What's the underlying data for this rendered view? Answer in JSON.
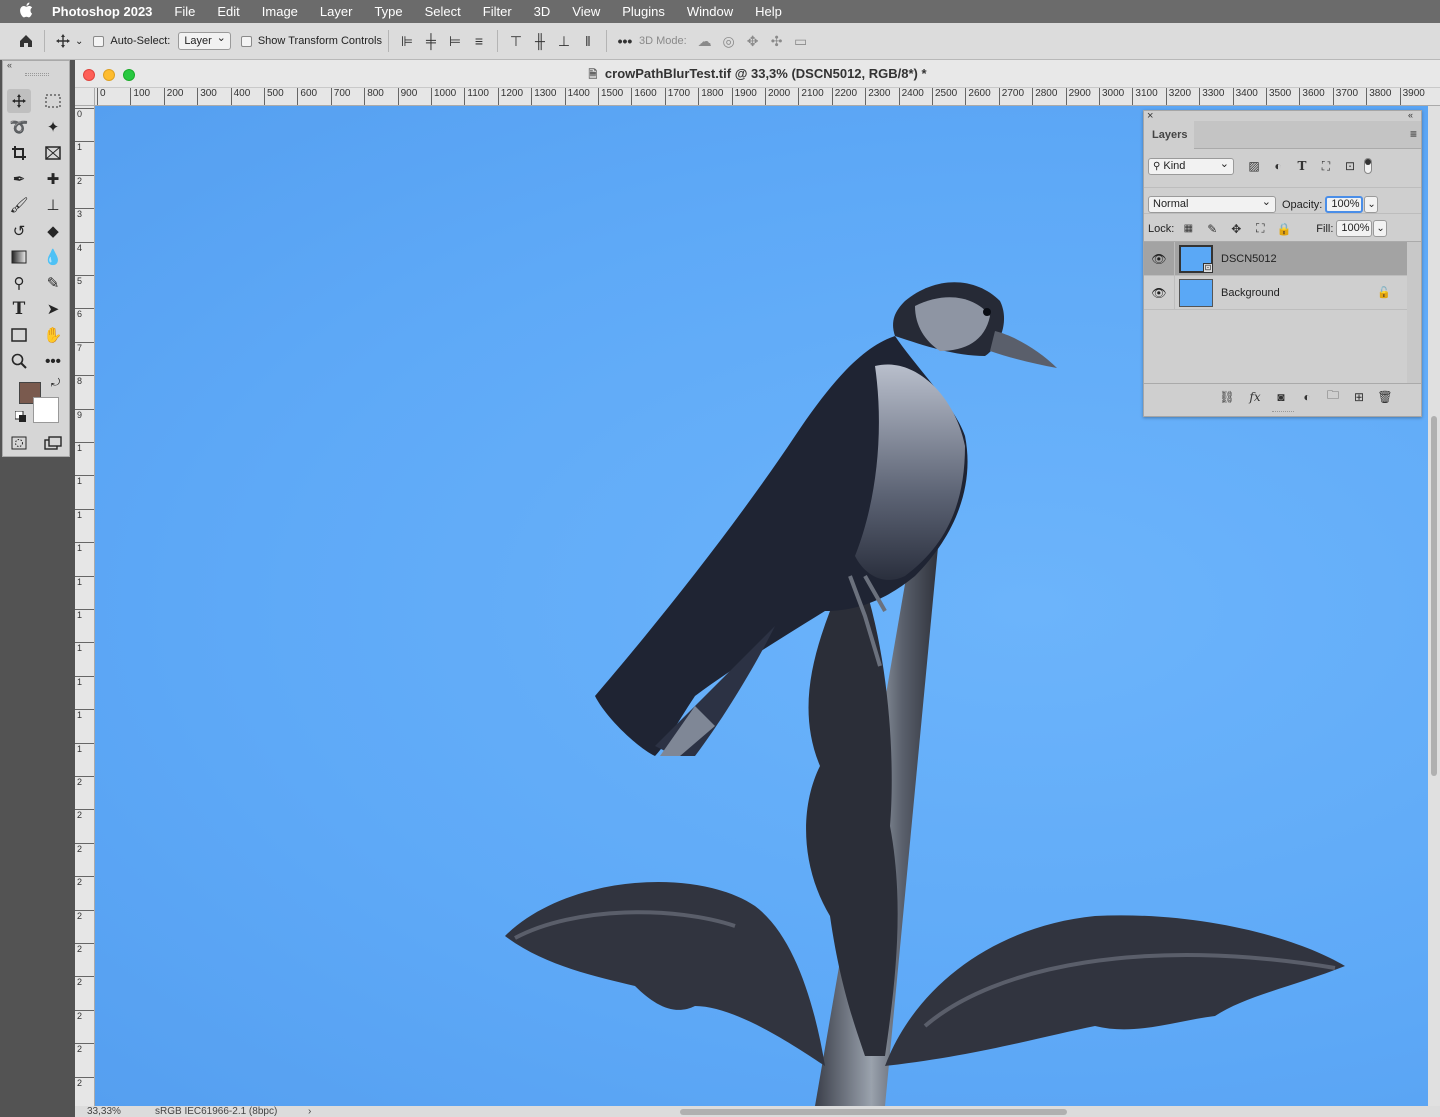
{
  "menubar": {
    "apple": "",
    "app_name": "Photoshop 2023",
    "items": [
      "File",
      "Edit",
      "Image",
      "Layer",
      "Type",
      "Select",
      "Filter",
      "3D",
      "View",
      "Plugins",
      "Window",
      "Help"
    ]
  },
  "options": {
    "auto_select_label": "Auto-Select:",
    "auto_select_value": "Layer",
    "show_transform_label": "Show Transform Controls",
    "three_d_mode_label": "3D Mode:"
  },
  "document": {
    "title": "crowPathBlurTest.tif @ 33,3% (DSCN5012, RGB/8*) *",
    "ruler_h": [
      "0",
      "100",
      "200",
      "300",
      "400",
      "500",
      "600",
      "700",
      "800",
      "900",
      "1000",
      "1100",
      "1200",
      "1300",
      "1400",
      "1500",
      "1600",
      "1700",
      "1800",
      "1900",
      "2000",
      "2100",
      "2200",
      "2300",
      "2400",
      "2500",
      "2600",
      "2700",
      "2800",
      "2900",
      "3000",
      "3100",
      "3200",
      "3300",
      "3400",
      "3500",
      "3600",
      "3700",
      "3800",
      "3900"
    ],
    "ruler_v": [
      "0",
      "1",
      "2",
      "3",
      "4",
      "5",
      "6",
      "7",
      "8",
      "9",
      "1",
      "1",
      "1",
      "1",
      "1",
      "1",
      "1",
      "1",
      "1",
      "1",
      "2",
      "2",
      "2",
      "2",
      "2",
      "2",
      "2",
      "2",
      "2",
      "2"
    ],
    "zoom": "33,33%",
    "profile": "sRGB IEC61966-2.1 (8bpc)",
    "status_arrow": "›"
  },
  "colors": {
    "foreground": "#7a5a4e",
    "background": "#ffffff",
    "sky": "#5ea9f7"
  },
  "layers_panel": {
    "tab": "Layers",
    "filter_kind": "Kind",
    "blend_mode": "Normal",
    "opacity_label": "Opacity:",
    "opacity_value": "100%",
    "lock_label": "Lock:",
    "fill_label": "Fill:",
    "fill_value": "100%",
    "layers": [
      {
        "name": "DSCN5012",
        "selected": true,
        "locked": false
      },
      {
        "name": "Background",
        "selected": false,
        "locked": true
      }
    ],
    "footer_icons": [
      "link-icon",
      "fx-icon",
      "mask-icon",
      "adjustment-icon",
      "group-folder-icon",
      "new-layer-icon",
      "trash-icon"
    ]
  }
}
